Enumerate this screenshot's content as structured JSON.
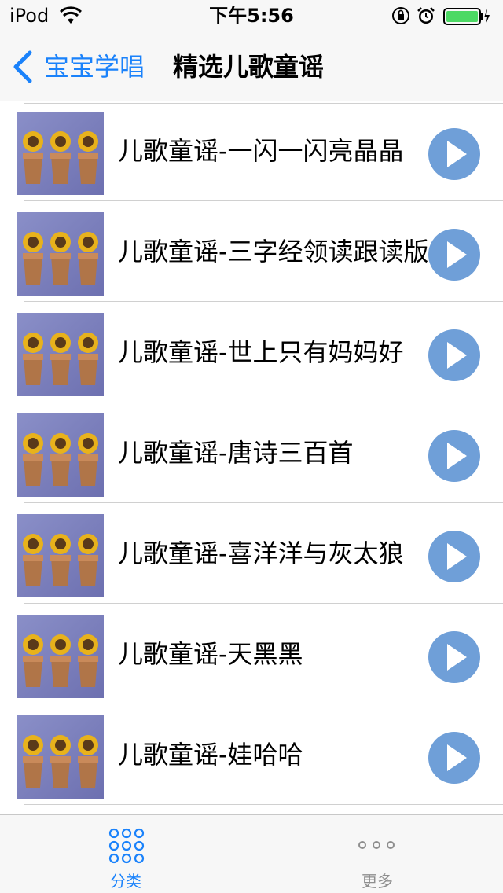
{
  "status_bar": {
    "device": "iPod",
    "time": "下午5:56",
    "wifi_icon": "wifi-icon",
    "lock_icon": "rotation-lock-icon",
    "alarm_icon": "alarm-icon",
    "battery_icon": "battery-icon",
    "battery_level": 1.0,
    "battery_color": "#4cd964"
  },
  "nav": {
    "back_label": "宝宝学唱",
    "title": "精选儿歌童谣",
    "accent_color": "#1a82fb"
  },
  "list": {
    "items": [
      {
        "title": "儿歌童谣-一闪一闪亮晶晶"
      },
      {
        "title": "儿歌童谣-三字经领读跟读版"
      },
      {
        "title": "儿歌童谣-世上只有妈妈好"
      },
      {
        "title": "儿歌童谣-唐诗三百首"
      },
      {
        "title": "儿歌童谣-喜洋洋与灰太狼"
      },
      {
        "title": "儿歌童谣-天黑黑"
      },
      {
        "title": "儿歌童谣-娃哈哈"
      }
    ],
    "play_icon": "play-icon",
    "play_color": "#6f9fd8"
  },
  "tabbar": {
    "tabs": [
      {
        "label": "分类",
        "icon": "grid-dots-icon",
        "selected": true
      },
      {
        "label": "更多",
        "icon": "more-dots-icon",
        "selected": false
      }
    ]
  }
}
